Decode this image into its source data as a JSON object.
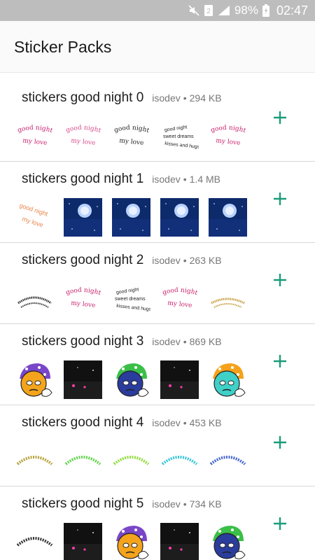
{
  "status_bar": {
    "battery": "98%",
    "time": "02:47"
  },
  "app": {
    "title": "Sticker Packs"
  },
  "colors": {
    "accent": "#1b9d7a",
    "status_bar": "#bdbdbd"
  },
  "packs": [
    {
      "name": "stickers good night 0",
      "publisher": "isodev",
      "size": "294 KB",
      "stickers": [
        "text-pink",
        "text-pink-small",
        "text-black",
        "text-black-kisses",
        "text-pink"
      ]
    },
    {
      "name": "stickers good night 1",
      "publisher": "isodev",
      "size": "1.4 MB",
      "stickers": [
        "text-orange",
        "night-sky",
        "night-sky",
        "night-sky",
        "night-sky"
      ]
    },
    {
      "name": "stickers good night 2",
      "publisher": "isodev",
      "size": "263 KB",
      "stickers": [
        "text-black-small",
        "text-pink",
        "text-black-kisses",
        "text-pink",
        "text-gold"
      ]
    },
    {
      "name": "stickers good night 3",
      "publisher": "isodev",
      "size": "869 KB",
      "stickers": [
        "face-purple",
        "dark-scene",
        "face-green",
        "dark-scene",
        "face-orange"
      ]
    },
    {
      "name": "stickers good night 4",
      "publisher": "isodev",
      "size": "453 KB",
      "stickers": [
        "arc-yellow",
        "arc-green",
        "arc-lime",
        "arc-cyan",
        "arc-blue"
      ]
    },
    {
      "name": "stickers good night 5",
      "publisher": "isodev",
      "size": "734 KB",
      "stickers": [
        "arc-black",
        "dark-scene",
        "face-purple",
        "dark-scene",
        "face-green"
      ]
    }
  ]
}
